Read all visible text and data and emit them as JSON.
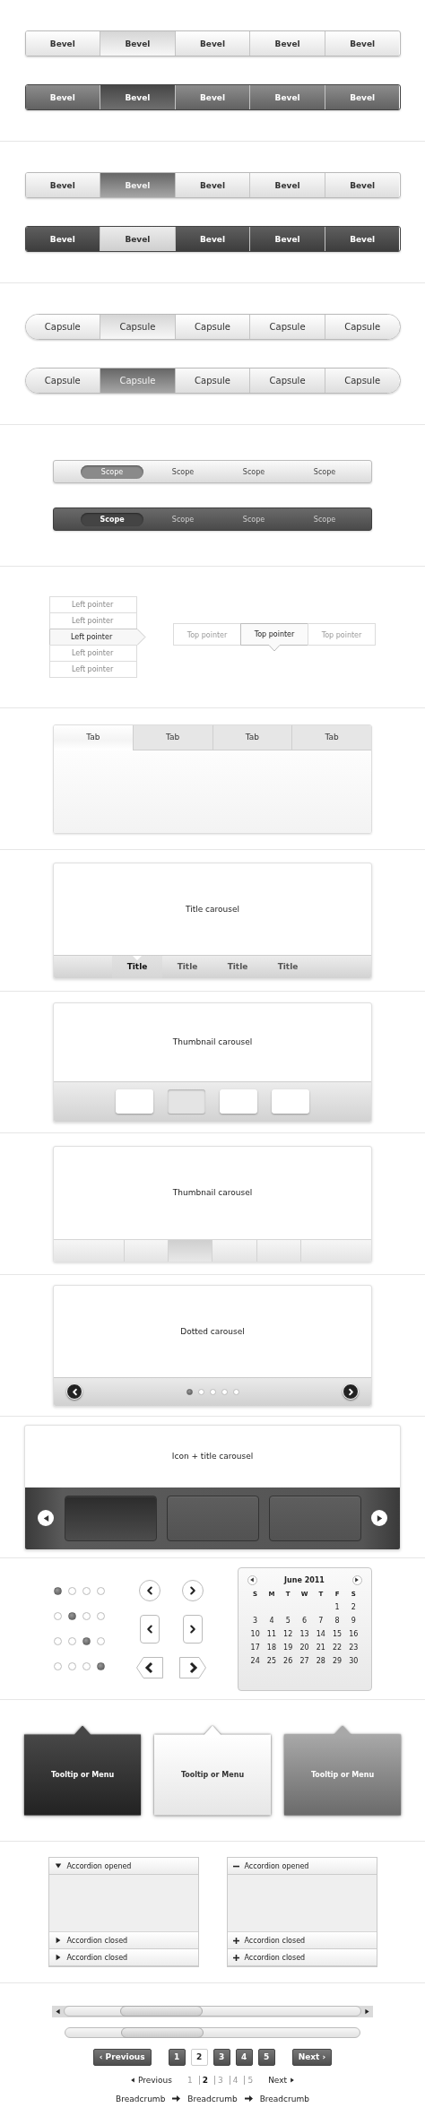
{
  "segmented_sections": [
    {
      "bars": [
        {
          "segments": [
            {
              "label": "Bevel",
              "selected": false
            },
            {
              "label": "Bevel",
              "selected": true
            },
            {
              "label": "Bevel",
              "selected": false
            },
            {
              "label": "Bevel",
              "selected": false
            },
            {
              "label": "Bevel",
              "selected": false
            }
          ]
        },
        {
          "segments": [
            {
              "label": "Bevel",
              "selected": false
            },
            {
              "label": "Bevel",
              "selected": true
            },
            {
              "label": "Bevel",
              "selected": false
            },
            {
              "label": "Bevel",
              "selected": false
            },
            {
              "label": "Bevel",
              "selected": false
            }
          ]
        }
      ]
    },
    {
      "bars": [
        {
          "segments": [
            {
              "label": "Bevel",
              "selected": false
            },
            {
              "label": "Bevel",
              "selected": true
            },
            {
              "label": "Bevel",
              "selected": false
            },
            {
              "label": "Bevel",
              "selected": false
            },
            {
              "label": "Bevel",
              "selected": false
            }
          ]
        },
        {
          "segments": [
            {
              "label": "Bevel",
              "selected": false
            },
            {
              "label": "Bevel",
              "selected": true
            },
            {
              "label": "Bevel",
              "selected": false
            },
            {
              "label": "Bevel",
              "selected": false
            },
            {
              "label": "Bevel",
              "selected": false
            }
          ]
        }
      ]
    },
    {
      "bars": [
        {
          "segments": [
            {
              "label": "Capsule",
              "selected": false
            },
            {
              "label": "Capsule",
              "selected": true
            },
            {
              "label": "Capsule",
              "selected": false
            },
            {
              "label": "Capsule",
              "selected": false
            },
            {
              "label": "Capsule",
              "selected": false
            }
          ]
        },
        {
          "segments": [
            {
              "label": "Capsule",
              "selected": false
            },
            {
              "label": "Capsule",
              "selected": true
            },
            {
              "label": "Capsule",
              "selected": false
            },
            {
              "label": "Capsule",
              "selected": false
            },
            {
              "label": "Capsule",
              "selected": false
            }
          ]
        }
      ]
    }
  ],
  "scope_bars": [
    {
      "items": [
        {
          "label": "Scope",
          "selected": true
        },
        {
          "label": "Scope",
          "selected": false
        },
        {
          "label": "Scope",
          "selected": false
        },
        {
          "label": "Scope",
          "selected": false
        }
      ]
    },
    {
      "items": [
        {
          "label": "Scope",
          "selected": true
        },
        {
          "label": "Scope",
          "selected": false
        },
        {
          "label": "Scope",
          "selected": false
        },
        {
          "label": "Scope",
          "selected": false
        }
      ]
    }
  ],
  "left_pointer": {
    "items": [
      {
        "label": "Left pointer",
        "selected": false
      },
      {
        "label": "Left pointer",
        "selected": false
      },
      {
        "label": "Left pointer",
        "selected": true
      },
      {
        "label": "Left pointer",
        "selected": false
      },
      {
        "label": "Left pointer",
        "selected": false
      }
    ]
  },
  "top_pointer": {
    "items": [
      {
        "label": "Top pointer",
        "selected": false
      },
      {
        "label": "Top pointer",
        "selected": true
      },
      {
        "label": "Top pointer",
        "selected": false
      }
    ]
  },
  "tabs": [
    {
      "label": "Tab",
      "selected": true
    },
    {
      "label": "Tab",
      "selected": false
    },
    {
      "label": "Tab",
      "selected": false
    },
    {
      "label": "Tab",
      "selected": false
    }
  ],
  "title_carousel": {
    "caption": "Title carousel",
    "titles": [
      {
        "label": "Title",
        "selected": true
      },
      {
        "label": "Title",
        "selected": false
      },
      {
        "label": "Title",
        "selected": false
      },
      {
        "label": "Title",
        "selected": false
      }
    ]
  },
  "thumbnail_carousel": {
    "caption": "Thumbnail carousel",
    "thumbnails": [
      {
        "selected": false
      },
      {
        "selected": true
      },
      {
        "selected": false
      },
      {
        "selected": false
      }
    ]
  },
  "strip_carousel": {
    "caption": "Thumbnail carousel",
    "segments": [
      {
        "selected": false
      },
      {
        "selected": false
      },
      {
        "selected": true
      },
      {
        "selected": false
      },
      {
        "selected": false
      },
      {
        "selected": false
      }
    ]
  },
  "dotted_carousel": {
    "caption": "Dotted carousel",
    "dots": [
      {
        "selected": true
      },
      {
        "selected": false
      },
      {
        "selected": false
      },
      {
        "selected": false
      },
      {
        "selected": false
      }
    ]
  },
  "icon_carousel": {
    "caption": "Icon + title carousel",
    "tiles": [
      {
        "selected": true
      },
      {
        "selected": false
      },
      {
        "selected": false
      }
    ]
  },
  "page_dots": [
    {
      "dots": [
        {
          "selected": true
        },
        {
          "selected": false
        },
        {
          "selected": false
        },
        {
          "selected": false
        }
      ]
    },
    {
      "dots": [
        {
          "selected": false
        },
        {
          "selected": true
        },
        {
          "selected": false
        },
        {
          "selected": false
        }
      ]
    },
    {
      "dots": [
        {
          "selected": false
        },
        {
          "selected": false
        },
        {
          "selected": true
        },
        {
          "selected": false
        }
      ]
    },
    {
      "dots": [
        {
          "selected": false
        },
        {
          "selected": false
        },
        {
          "selected": false
        },
        {
          "selected": true
        }
      ]
    }
  ],
  "arrow_buttons": [
    {
      "kind": "circle"
    },
    {
      "kind": "square"
    },
    {
      "kind": "pointer"
    }
  ],
  "calendar": {
    "title": "June 2011",
    "weekdays": [
      "S",
      "M",
      "T",
      "W",
      "T",
      "F",
      "S"
    ],
    "weeks": [
      [
        "1",
        "2"
      ],
      [
        "3",
        "4",
        "5",
        "6",
        "7",
        "8",
        "9"
      ],
      [
        "10",
        "11",
        "12",
        "13",
        "14",
        "15",
        "16"
      ],
      [
        "17",
        "18",
        "19",
        "20",
        "21",
        "22",
        "23"
      ],
      [
        "24",
        "25",
        "26",
        "27",
        "28",
        "29",
        "30"
      ]
    ]
  },
  "tooltips": [
    {
      "label": "Tooltip or Menu"
    },
    {
      "label": "Tooltip or Menu"
    },
    {
      "label": "Tooltip or Menu"
    }
  ],
  "accordions": [
    {
      "sections": [
        {
          "label": "Accordion opened",
          "expanded": true
        },
        {
          "label": "Accordion closed",
          "expanded": false
        },
        {
          "label": "Accordion closed",
          "expanded": false
        }
      ]
    },
    {
      "sections": [
        {
          "label": "Accordion opened",
          "expanded": true
        },
        {
          "label": "Accordion closed",
          "expanded": false
        },
        {
          "label": "Accordion closed",
          "expanded": false
        }
      ]
    }
  ],
  "pagination": {
    "previous": "‹ Previous",
    "pages": [
      {
        "label": "1",
        "selected": false
      },
      {
        "label": "2",
        "selected": true
      },
      {
        "label": "3",
        "selected": false
      },
      {
        "label": "4",
        "selected": false
      },
      {
        "label": "5",
        "selected": false
      }
    ],
    "next": "Next ›"
  },
  "text_pagination": {
    "previous": "Previous",
    "pages": [
      {
        "label": "1",
        "selected": false
      },
      {
        "label": "2",
        "selected": true
      },
      {
        "label": "3",
        "selected": false
      },
      {
        "label": "4",
        "selected": false
      },
      {
        "label": "5",
        "selected": false
      }
    ],
    "next": "Next"
  },
  "breadcrumbs": [
    "Breadcrumb",
    "Breadcrumb",
    "Breadcrumb"
  ]
}
